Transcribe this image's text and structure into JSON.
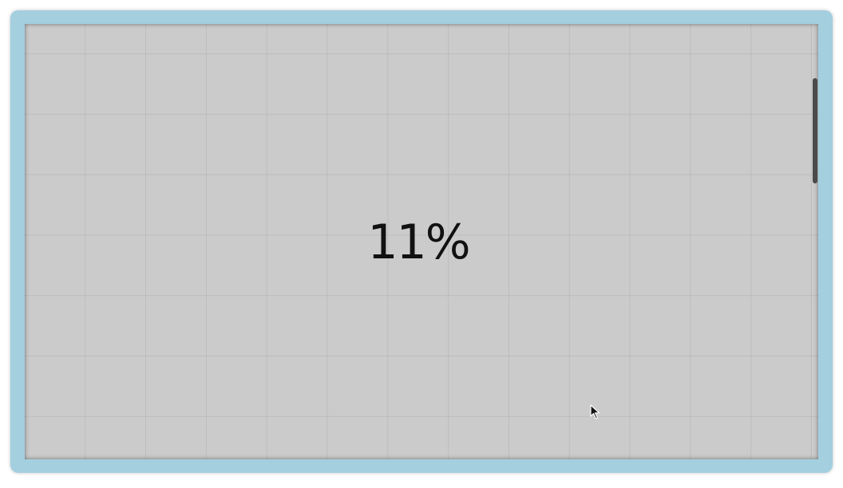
{
  "display": {
    "percent": "11%"
  },
  "colors": {
    "frame": "#a3cfdf",
    "canvas": "#cbcbcb",
    "grid": "#bcbcbc",
    "text": "#111111",
    "scrollbar": "#4a4a4a"
  },
  "icons": {
    "cursor": "mouse-pointer-icon"
  }
}
